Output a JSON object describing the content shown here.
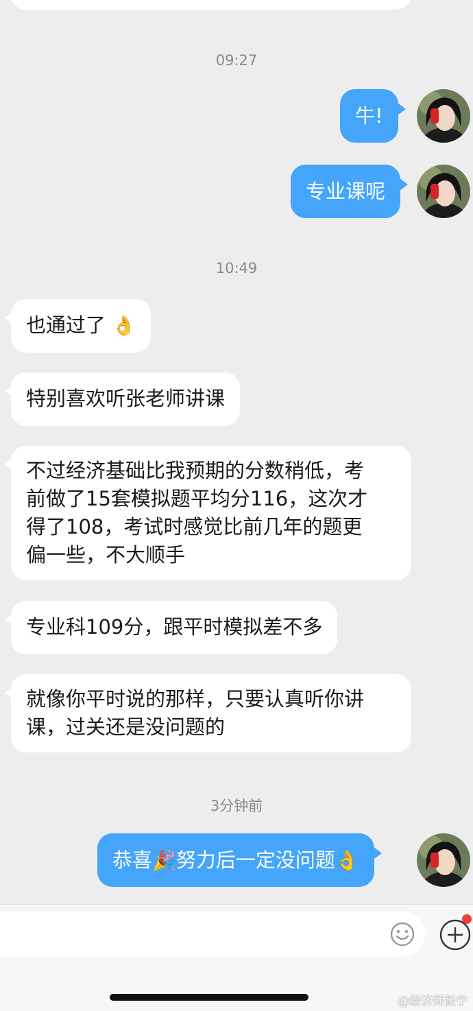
{
  "chat": {
    "time_1": "09:27",
    "msg_out_1": "牛!",
    "msg_out_2": "专业课呢",
    "time_2": "10:49",
    "msg_in_1": "也通过了",
    "msg_in_1_emoji": "👌",
    "msg_in_2": "特别喜欢听张老师讲课",
    "msg_in_3_lines": [
      "不过经济基础比我预期的分数稍低，考",
      "前做了15套模拟题平均分116，这次才",
      "得了108，考试时感觉比前几年的题更",
      "偏一些，不大顺手"
    ],
    "msg_in_4": "专业科109分，跟平时模拟差不多",
    "msg_in_5_lines": [
      "就像你平时说的那样，只要认真听你讲",
      "课，过关还是没问题的"
    ],
    "time_3": "3分钟前",
    "msg_out_3_part1": "恭喜",
    "msg_out_3_emoji1": "🎉",
    "msg_out_3_part2": "努力后一定没问题",
    "msg_out_3_emoji2": "👌"
  },
  "input": {
    "emoji_icon": "smiley-face-icon",
    "plus_icon": "plus-circle-icon",
    "badge_color": "#f23b3b"
  },
  "watermark": "@经济师张宁",
  "colors": {
    "background": "#ededed",
    "outgoing_bubble": "#44a5fa",
    "incoming_bubble": "#ffffff"
  }
}
